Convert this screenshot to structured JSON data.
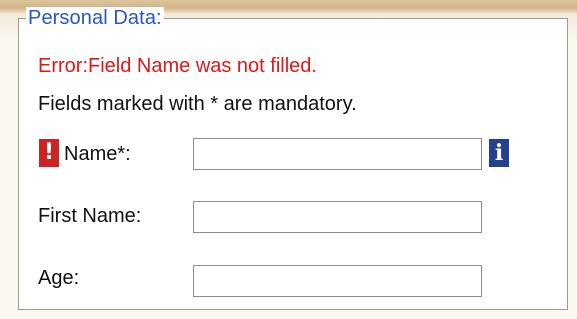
{
  "form": {
    "legend": "Personal Data:",
    "error_message": "Error:Field Name was not filled.",
    "mandatory_hint": "Fields marked with * are mandatory.",
    "error_icon": {
      "name": "exclamation-icon",
      "glyph": "!",
      "color": "#cc2424"
    },
    "info_icon": {
      "name": "info-icon",
      "glyph": "i",
      "color": "#23418f"
    },
    "fields": [
      {
        "label": "Name*:",
        "value": "",
        "placeholder": ""
      },
      {
        "label": "First Name:",
        "value": "",
        "placeholder": ""
      },
      {
        "label": "Age:",
        "value": "",
        "placeholder": ""
      }
    ]
  },
  "colors": {
    "legend": "#2858b8",
    "error_text": "#e01818",
    "border": "#9a9a9a"
  }
}
